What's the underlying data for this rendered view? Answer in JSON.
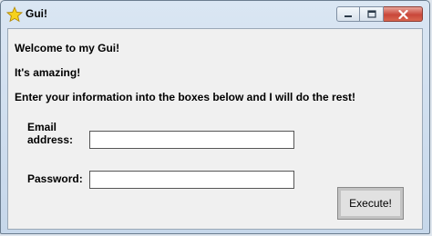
{
  "window": {
    "title": "Gui!",
    "controls": {
      "minimize_icon": "minimize-icon",
      "maximize_icon": "maximize-icon",
      "close_icon": "close-icon"
    },
    "accent_colors": {
      "titlebar": "#c6d7ea",
      "close_button": "#c9473a",
      "client_background": "#f0f0f0"
    }
  },
  "content": {
    "welcome": "Welcome to my Gui!",
    "amazing": "It's amazing!",
    "instructions": "Enter your information into the boxes below and I will do the rest!",
    "email_label_line1": "Email",
    "email_label_line2": "address:",
    "email_value": "",
    "password_label": "Password:",
    "password_value": "",
    "execute_label": "Execute!"
  }
}
